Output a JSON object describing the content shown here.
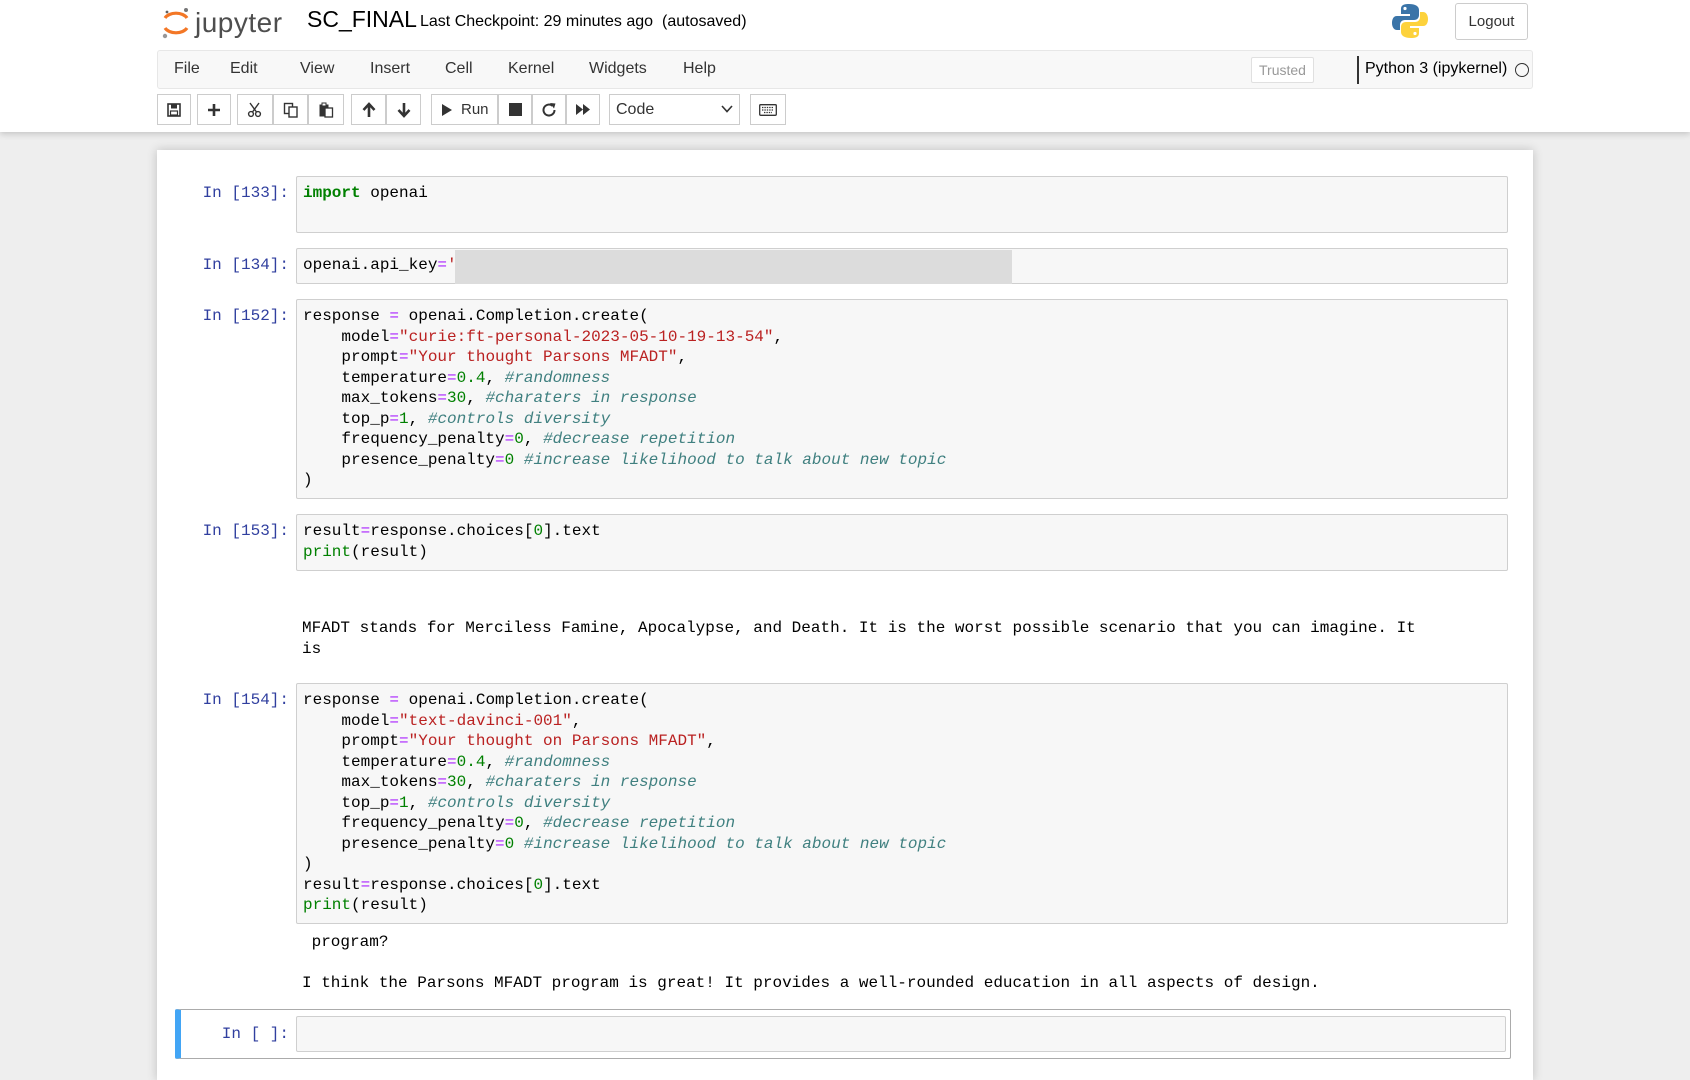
{
  "app": {
    "logo_text": "jupyter",
    "notebook_name": "SC_FINAL",
    "checkpoint": "Last Checkpoint: 29 minutes ago",
    "autosave": "(autosaved)",
    "logout_label": "Logout"
  },
  "menu": {
    "items": [
      "File",
      "Edit",
      "View",
      "Insert",
      "Cell",
      "Kernel",
      "Widgets",
      "Help"
    ],
    "trusted": "Trusted",
    "kernel": "Python 3 (ipykernel)"
  },
  "toolbar": {
    "run_label": "Run",
    "cell_type": "Code",
    "icons": [
      "save-icon",
      "plus-icon",
      "cut-icon",
      "copy-icon",
      "paste-icon",
      "arrow-up-icon",
      "arrow-down-icon",
      "run-icon",
      "stop-icon",
      "restart-icon",
      "fast-forward-icon",
      "keyboard-icon"
    ]
  },
  "cells": [
    {
      "prompt": "In [133]:",
      "lines": [
        [
          {
            "t": "import",
            "c": "kw"
          },
          {
            "t": " openai"
          }
        ]
      ]
    },
    {
      "prompt": "In [134]:",
      "lines": [
        [
          {
            "t": "openai.api_key"
          },
          {
            "t": "=",
            "c": "op"
          },
          {
            "t": "'",
            "c": "str"
          }
        ]
      ]
    },
    {
      "prompt": "In [152]:",
      "lines": [
        [
          {
            "t": "response "
          },
          {
            "t": "=",
            "c": "op"
          },
          {
            "t": " openai.Completion.create("
          }
        ],
        [
          {
            "t": "    model"
          },
          {
            "t": "=",
            "c": "op"
          },
          {
            "t": "\"curie:ft-personal-2023-05-10-19-13-54\"",
            "c": "str"
          },
          {
            "t": ","
          }
        ],
        [
          {
            "t": "    prompt"
          },
          {
            "t": "=",
            "c": "op"
          },
          {
            "t": "\"Your thought Parsons MFADT\"",
            "c": "str"
          },
          {
            "t": ","
          }
        ],
        [
          {
            "t": "    temperature"
          },
          {
            "t": "=",
            "c": "op"
          },
          {
            "t": "0.4",
            "c": "num"
          },
          {
            "t": ", "
          },
          {
            "t": "#randomness",
            "c": "cm"
          }
        ],
        [
          {
            "t": "    max_tokens"
          },
          {
            "t": "=",
            "c": "op"
          },
          {
            "t": "30",
            "c": "num"
          },
          {
            "t": ", "
          },
          {
            "t": "#charaters in response",
            "c": "cm"
          }
        ],
        [
          {
            "t": "    top_p"
          },
          {
            "t": "=",
            "c": "op"
          },
          {
            "t": "1",
            "c": "num"
          },
          {
            "t": ", "
          },
          {
            "t": "#controls diversity",
            "c": "cm"
          }
        ],
        [
          {
            "t": "    frequency_penalty"
          },
          {
            "t": "=",
            "c": "op"
          },
          {
            "t": "0",
            "c": "num"
          },
          {
            "t": ", "
          },
          {
            "t": "#decrease repetition",
            "c": "cm"
          }
        ],
        [
          {
            "t": "    presence_penalty"
          },
          {
            "t": "=",
            "c": "op"
          },
          {
            "t": "0",
            "c": "num"
          },
          {
            "t": " "
          },
          {
            "t": "#increase likelihood to talk about new topic",
            "c": "cm"
          }
        ],
        [
          {
            "t": ")"
          }
        ]
      ]
    },
    {
      "prompt": "In [153]:",
      "lines": [
        [
          {
            "t": "result"
          },
          {
            "t": "=",
            "c": "op"
          },
          {
            "t": "response.choices["
          },
          {
            "t": "0",
            "c": "num"
          },
          {
            "t": "].text"
          }
        ],
        [
          {
            "t": "print",
            "c": "bi"
          },
          {
            "t": "(result)"
          }
        ]
      ],
      "output": "\n\nMFADT stands for Merciless Famine, Apocalypse, and Death. It is the worst possible scenario that you can imagine. It\nis"
    },
    {
      "prompt": "In [154]:",
      "lines": [
        [
          {
            "t": "response "
          },
          {
            "t": "=",
            "c": "op"
          },
          {
            "t": " openai.Completion.create("
          }
        ],
        [
          {
            "t": "    model"
          },
          {
            "t": "=",
            "c": "op"
          },
          {
            "t": "\"text-davinci-001\"",
            "c": "str"
          },
          {
            "t": ","
          }
        ],
        [
          {
            "t": "    prompt"
          },
          {
            "t": "=",
            "c": "op"
          },
          {
            "t": "\"Your thought on Parsons MFADT\"",
            "c": "str"
          },
          {
            "t": ","
          }
        ],
        [
          {
            "t": "    temperature"
          },
          {
            "t": "=",
            "c": "op"
          },
          {
            "t": "0.4",
            "c": "num"
          },
          {
            "t": ", "
          },
          {
            "t": "#randomness",
            "c": "cm"
          }
        ],
        [
          {
            "t": "    max_tokens"
          },
          {
            "t": "=",
            "c": "op"
          },
          {
            "t": "30",
            "c": "num"
          },
          {
            "t": ", "
          },
          {
            "t": "#charaters in response",
            "c": "cm"
          }
        ],
        [
          {
            "t": "    top_p"
          },
          {
            "t": "=",
            "c": "op"
          },
          {
            "t": "1",
            "c": "num"
          },
          {
            "t": ", "
          },
          {
            "t": "#controls diversity",
            "c": "cm"
          }
        ],
        [
          {
            "t": "    frequency_penalty"
          },
          {
            "t": "=",
            "c": "op"
          },
          {
            "t": "0",
            "c": "num"
          },
          {
            "t": ", "
          },
          {
            "t": "#decrease repetition",
            "c": "cm"
          }
        ],
        [
          {
            "t": "    presence_penalty"
          },
          {
            "t": "=",
            "c": "op"
          },
          {
            "t": "0",
            "c": "num"
          },
          {
            "t": " "
          },
          {
            "t": "#increase likelihood to talk about new topic",
            "c": "cm"
          }
        ],
        [
          {
            "t": ")"
          }
        ],
        [
          {
            "t": "result"
          },
          {
            "t": "=",
            "c": "op"
          },
          {
            "t": "response.choices["
          },
          {
            "t": "0",
            "c": "num"
          },
          {
            "t": "].text"
          }
        ],
        [
          {
            "t": "print",
            "c": "bi"
          },
          {
            "t": "(result)"
          }
        ]
      ],
      "output": " program?\n\nI think the Parsons MFADT program is great! It provides a well-rounded education in all aspects of design."
    },
    {
      "prompt": "In [ ]:",
      "lines": []
    }
  ],
  "colors": {
    "prompt": "#303f9f",
    "keyword": "#008000",
    "operator": "#aa22ff",
    "string": "#ba2121",
    "comment": "#408080",
    "selected_cell_bar": "#42a5f5"
  }
}
